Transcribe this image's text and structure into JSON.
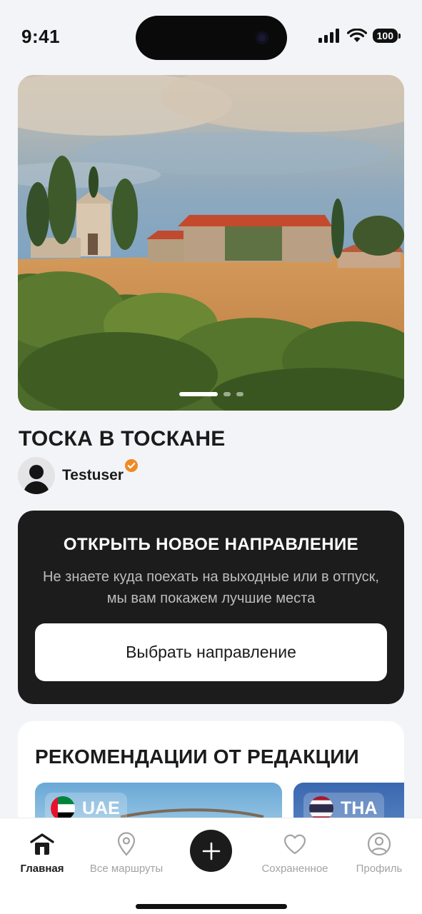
{
  "status_bar": {
    "time": "9:41",
    "battery": "100"
  },
  "hero": {
    "slides_total": 3,
    "active_slide": 1
  },
  "route": {
    "title": "ТОСКА В ТОСКАНЕ",
    "author": "Testuser"
  },
  "promo": {
    "title": "ОТКРЫТЬ НОВОЕ НАПРАВЛЕНИЕ",
    "text": "Не знаете куда поехать на выходные или в отпуск, мы вам покажем лучшие места",
    "button_label": "Выбрать направление"
  },
  "editorial": {
    "title": "РЕКОМЕНДАЦИИ ОТ РЕДАКЦИИ",
    "destinations": [
      {
        "code": "UAE",
        "flag": "uae-flag"
      },
      {
        "code": "THA",
        "flag": "thailand-flag"
      }
    ]
  },
  "tabbar": {
    "home": "Главная",
    "routes": "Все маршруты",
    "saved": "Сохраненное",
    "profile": "Профиль"
  },
  "colors": {
    "accent": "#f08a24",
    "dark_card": "#1c1c1c",
    "background": "#f3f4f7"
  }
}
